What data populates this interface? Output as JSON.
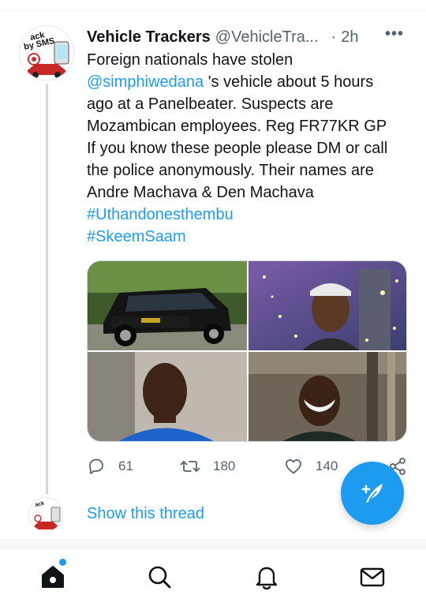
{
  "tweet": {
    "display_name": "Vehicle Trackers",
    "handle": "@VehicleTra...",
    "dot": "·",
    "time": "2h",
    "more": "•••",
    "body_line1": "Foreign nationals have stolen",
    "mention": "@simphiwedana",
    "body_line2_rest": " 's vehicle about 5 hours",
    "body_line3": "ago at a Panelbeater. Suspects are",
    "body_line4": "Mozambican employees. Reg FR77KR GP",
    "body_line5": "If you know these people please DM or call",
    "body_line6": "the police anonymously. Their names are",
    "body_line7": "Andre Machava & Den Machava",
    "hashtag1": "#Uthandonesthembu",
    "hashtag2": "#SkeemSaam",
    "avatar_text_line1": "ack",
    "avatar_text_line2": "by SMS",
    "media_descriptions": [
      "black-suv-photo",
      "man-selfie-1",
      "man-selfie-2",
      "man-selfie-3"
    ],
    "actions": {
      "reply_count": "61",
      "retweet_count": "180",
      "like_count": "140"
    }
  },
  "thread": {
    "show_label": "Show this thread"
  },
  "nav": {
    "items": [
      "home-icon",
      "search-icon",
      "notifications-icon",
      "messages-icon"
    ]
  },
  "colors": {
    "accent": "#1d9bf0",
    "text": "#0f1419",
    "muted": "#536471"
  }
}
